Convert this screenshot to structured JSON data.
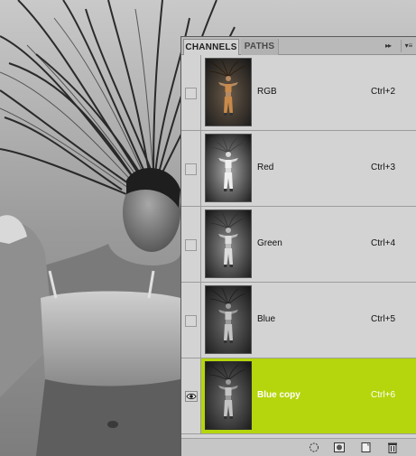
{
  "panel": {
    "tabs": [
      {
        "label": "CHANNELS"
      },
      {
        "label": "PATHS"
      }
    ],
    "collapse_glyph": "▸▸",
    "menu_glyph": "▾≡"
  },
  "channels": [
    {
      "name": "RGB",
      "shortcut": "Ctrl+2",
      "visible": false,
      "selected": false,
      "tint": "color"
    },
    {
      "name": "Red",
      "shortcut": "Ctrl+3",
      "visible": false,
      "selected": false,
      "tint": "light"
    },
    {
      "name": "Green",
      "shortcut": "Ctrl+4",
      "visible": false,
      "selected": false,
      "tint": "mid"
    },
    {
      "name": "Blue",
      "shortcut": "Ctrl+5",
      "visible": false,
      "selected": false,
      "tint": "dark"
    },
    {
      "name": "Blue copy",
      "shortcut": "Ctrl+6",
      "visible": true,
      "selected": true,
      "tint": "dark"
    }
  ],
  "toolbar": {
    "icons": [
      "load-selection-icon",
      "save-selection-icon",
      "new-channel-icon",
      "trash-icon"
    ]
  },
  "colors": {
    "selected_row": "#b5d60c",
    "panel_bg": "#d3d3d3"
  }
}
